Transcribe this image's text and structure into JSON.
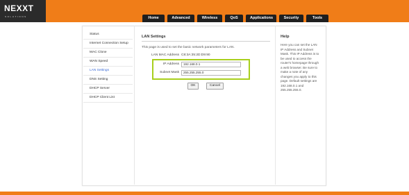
{
  "brand": {
    "logo": "NEXXT",
    "tagline": "SOLUTIONS"
  },
  "nav": {
    "tabs": [
      "Home",
      "Advanced",
      "Wireless",
      "QoS",
      "Applications",
      "Security",
      "Tools"
    ]
  },
  "sidebar": {
    "items": [
      {
        "label": "Status"
      },
      {
        "label": "Internet Connection Setup"
      },
      {
        "label": "MAC Clone"
      },
      {
        "label": "WAN Speed"
      },
      {
        "label": "LAN Settings",
        "active": true
      },
      {
        "label": "DNS Setting"
      },
      {
        "label": "DHCP Server"
      },
      {
        "label": "DHCP Client List"
      }
    ]
  },
  "main": {
    "title": "LAN Settings",
    "description": "This page is used to set the basic network parameters for LAN.",
    "mac_label": "LAN MAC Address",
    "mac_value": "C8:3A:35:2D:D9:90",
    "ip_label": "IP Address",
    "ip_value": "192.168.0.1",
    "mask_label": "Subnet Mask",
    "mask_value": "255.255.255.0",
    "ok_label": "OK",
    "cancel_label": "Cancel"
  },
  "help": {
    "title": "Help",
    "text": "Here you can set the LAN IP Address and Subnet Mask. This IP Address is to be used to access the router's homepage through a web browser. Be sure to make a note of any changes you apply to this page. Default settings are 192.168.0.1 and 255.255.255.0."
  },
  "colors": {
    "accent": "#f07d18",
    "highlight": "#a8cf1c",
    "active_link": "#3a6ad6"
  }
}
